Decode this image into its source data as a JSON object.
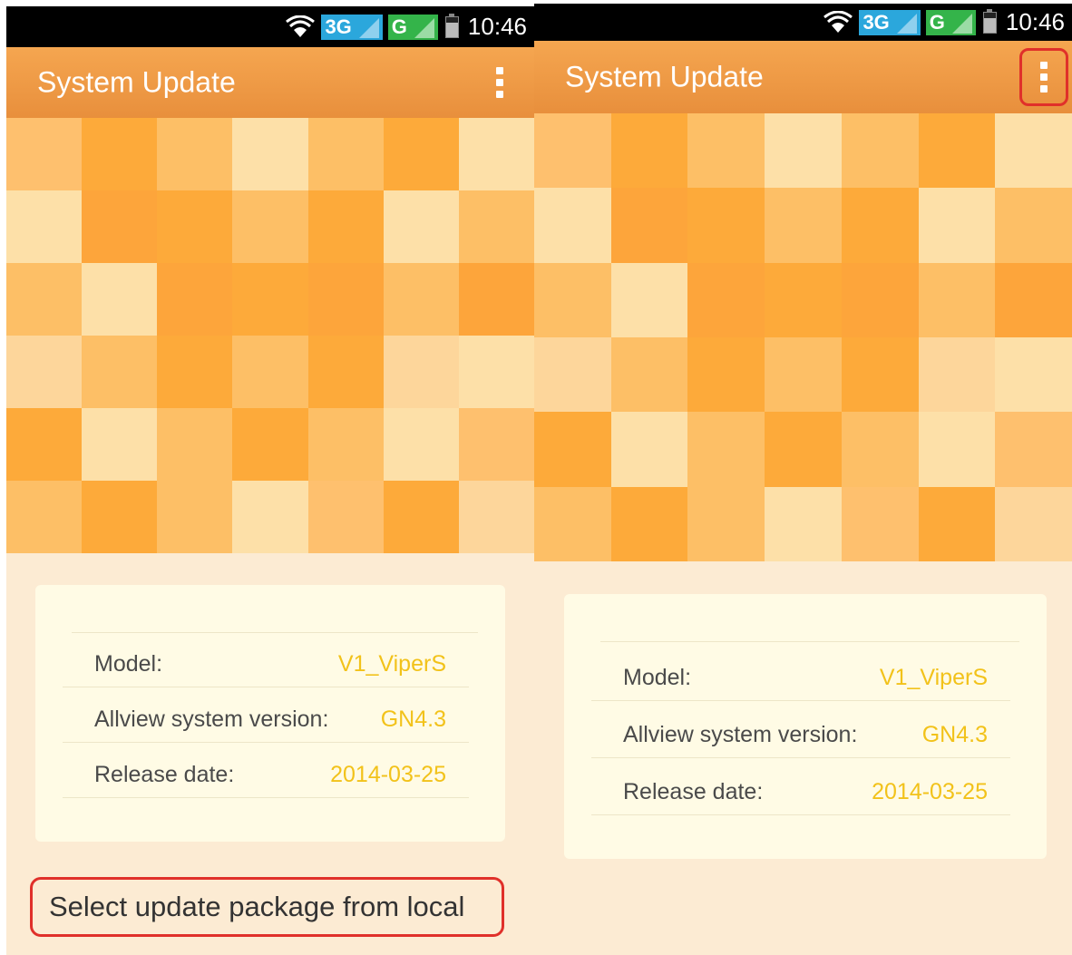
{
  "status_bar": {
    "time": "10:46",
    "net1": "3G",
    "net2": "G"
  },
  "app_bar": {
    "title": "System Update"
  },
  "info": {
    "model_label": "Model:",
    "model_value": "V1_ViperS",
    "version_label": "Allview system version:",
    "version_value": "GN4.3",
    "date_label": "Release date:",
    "date_value": "2014-03-25"
  },
  "local_button": {
    "label": "Select update package from local"
  },
  "colors": {
    "app_bar": "#ee9a45",
    "background": "#fcebd3",
    "card": "#fffbe5",
    "value_text": "#f2c21a",
    "highlight": "#e0302a",
    "tile_palette": [
      "#fec06e",
      "#fdaa3a",
      "#fdbf66",
      "#fde0a8",
      "#fdb653",
      "#fda53b",
      "#fdd69b"
    ]
  },
  "mosaic_pattern": [
    [
      0,
      1,
      2,
      3,
      2,
      1,
      3
    ],
    [
      3,
      5,
      1,
      2,
      1,
      3,
      2
    ],
    [
      2,
      3,
      5,
      1,
      5,
      2,
      5
    ],
    [
      6,
      2,
      1,
      2,
      1,
      6,
      3
    ],
    [
      1,
      3,
      2,
      1,
      2,
      3,
      0
    ],
    [
      2,
      1,
      2,
      3,
      0,
      1,
      6
    ]
  ]
}
